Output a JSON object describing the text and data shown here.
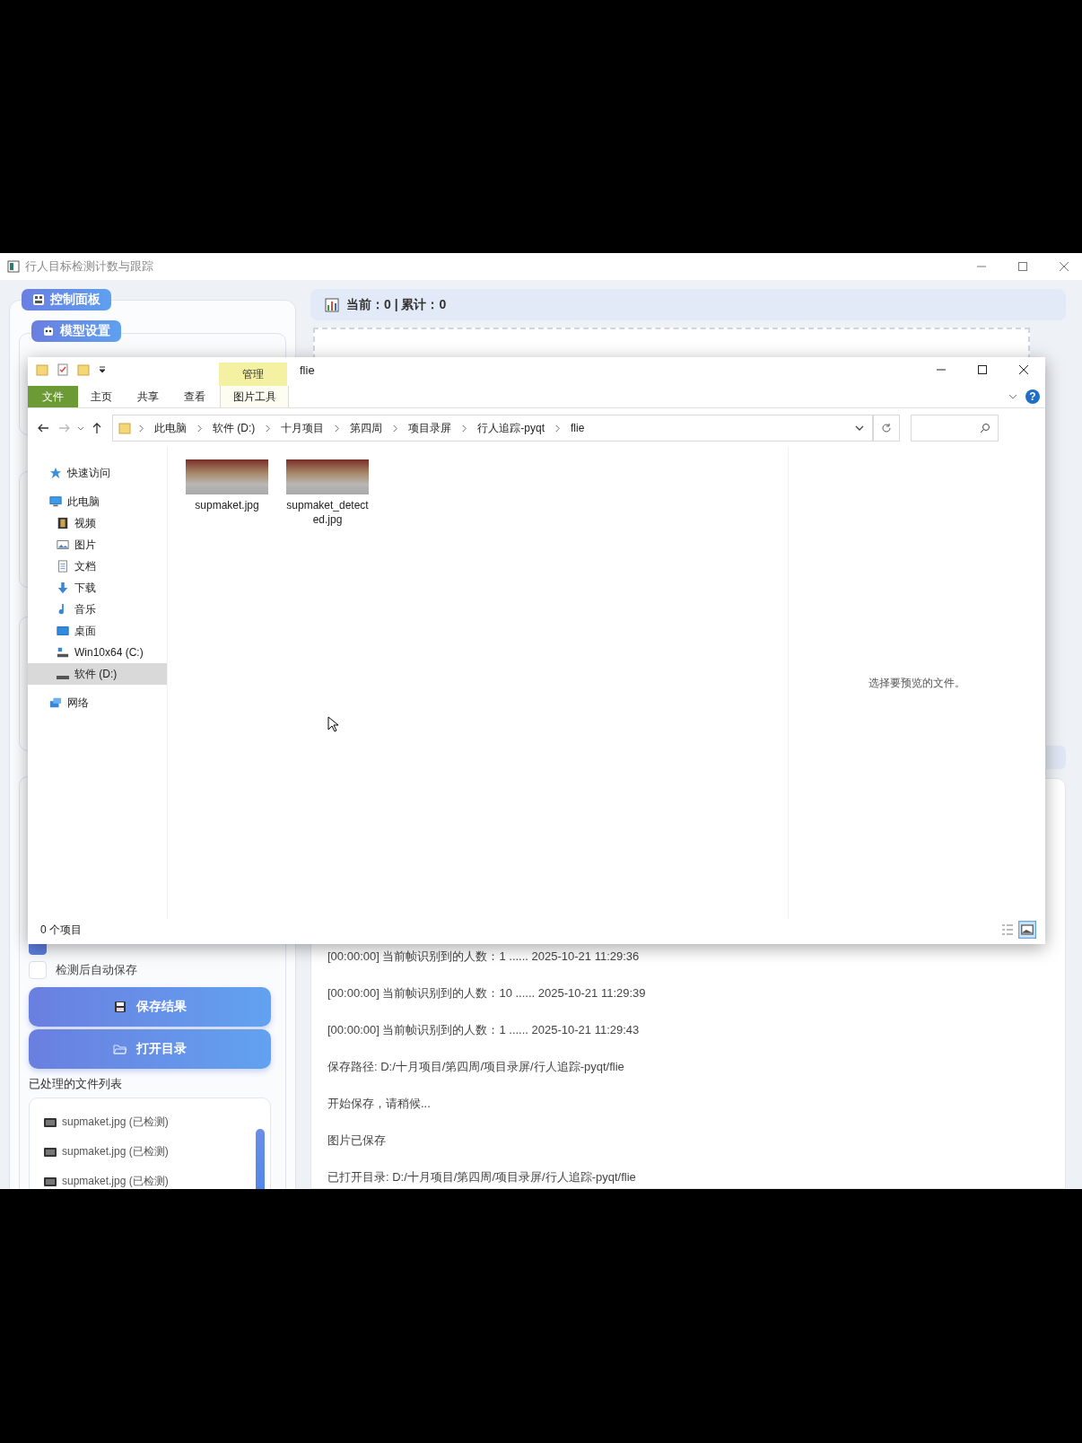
{
  "app_window": {
    "title": "行人目标检测计数与跟踪"
  },
  "control_panel": {
    "title": "控制面板",
    "model_settings": {
      "title": "模型设置"
    },
    "options": [
      {
        "checked": true
      },
      {
        "label": "检测后自动保存",
        "checked": false
      }
    ],
    "buttons": [
      {
        "kind": "save",
        "label": "保存结果"
      },
      {
        "kind": "open",
        "label": "打开目录"
      }
    ],
    "file_list": {
      "title": "已处理的文件列表",
      "items": [
        "supmaket.jpg (已检测)",
        "supmaket.jpg (已检测)",
        "supmaket.jpg (已检测)"
      ]
    }
  },
  "stats": {
    "text": "当前：0 | 累计：0"
  },
  "log": {
    "lines": [
      "[00:00:00] 当前帧识别到的人数：1 ...... 2025-10-21 11:29:36",
      "[00:00:00] 当前帧识别到的人数：10 ...... 2025-10-21 11:29:39",
      "[00:00:00] 当前帧识别到的人数：1 ...... 2025-10-21 11:29:43",
      "保存路径: D:/十月项目/第四周/项目录屏/行人追踪-pyqt/flie",
      "开始保存，请稍候...",
      "图片已保存",
      "已打开目录: D:/十月项目/第四周/项目录屏/行人追踪-pyqt/flie"
    ]
  },
  "explorer": {
    "title": "flie",
    "context_tab": "管理",
    "help": "?",
    "ribbon_tabs": [
      {
        "kind": "file",
        "label": "文件"
      },
      {
        "kind": "tab",
        "label": "主页"
      },
      {
        "kind": "tab",
        "label": "共享"
      },
      {
        "kind": "tab",
        "label": "查看"
      },
      {
        "kind": "context",
        "label": "图片工具"
      }
    ],
    "breadcrumbs": [
      "此电脑",
      "软件 (D:)",
      "十月项目",
      "第四周",
      "项目录屏",
      "行人追踪-pyqt",
      "flie"
    ],
    "nav": [
      {
        "kind": "star",
        "label": "快速访问",
        "selected": false
      },
      {
        "kind": "pc",
        "label": "此电脑",
        "selected": false,
        "children": [
          {
            "kind": "video",
            "label": "视频",
            "selected": false
          },
          {
            "kind": "pictures",
            "label": "图片",
            "selected": false
          },
          {
            "kind": "docs",
            "label": "文档",
            "selected": false
          },
          {
            "kind": "downloads",
            "label": "下载",
            "selected": false
          },
          {
            "kind": "music",
            "label": "音乐",
            "selected": false
          },
          {
            "kind": "desktop",
            "label": "桌面",
            "selected": false
          },
          {
            "kind": "drive_c",
            "label": "Win10x64 (C:)",
            "selected": false
          },
          {
            "kind": "drive_d",
            "label": "软件 (D:)",
            "selected": true
          }
        ]
      },
      {
        "kind": "network",
        "label": "网络",
        "selected": false
      }
    ],
    "files": [
      {
        "name": "supmaket.jpg"
      },
      {
        "name": "supmaket_detected.jpg"
      }
    ],
    "preview_message": "选择要预览的文件。",
    "status": "0 个项目"
  }
}
